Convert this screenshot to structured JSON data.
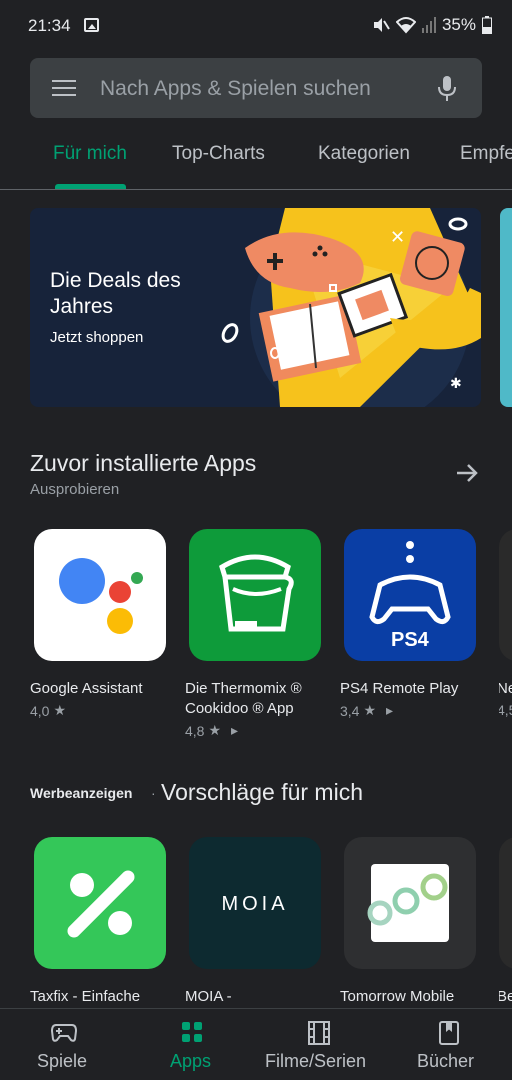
{
  "status_bar": {
    "time": "21:34",
    "battery": "35%"
  },
  "search": {
    "placeholder": "Nach Apps & Spielen suchen"
  },
  "tabs": [
    {
      "label": "Für mich",
      "active": true
    },
    {
      "label": "Top-Charts",
      "active": false
    },
    {
      "label": "Kategorien",
      "active": false
    },
    {
      "label": "Empfe",
      "active": false
    }
  ],
  "banner": {
    "title": "Die Deals des Jahres",
    "cta": "Jetzt shoppen"
  },
  "section_installed": {
    "title": "Zuvor installierte Apps",
    "subtitle": "Ausprobieren",
    "apps": [
      {
        "name_line1": "Google Assistant",
        "name_line2": "",
        "rating": "4,0",
        "icon": "google-assistant-icon"
      },
      {
        "name_line1": "Die Thermomix ®",
        "name_line2": "Cookidoo ® App",
        "rating": "4,8",
        "icon": "thermomix-icon"
      },
      {
        "name_line1": "PS4 Remote Play",
        "name_line2": "",
        "rating": "3,4",
        "icon": "ps4-icon"
      },
      {
        "name_line1": "Ne",
        "name_line2": "",
        "rating": "4,5",
        "icon": "partial-app-icon"
      }
    ],
    "ps4_label": "PS4"
  },
  "section_suggested": {
    "ads_label": "Werbeanzeigen",
    "separator": "·",
    "title": "Vorschläge für mich",
    "apps": [
      {
        "name": "Taxfix - Einfache",
        "icon": "taxfix-icon"
      },
      {
        "name": "MOIA -",
        "icon": "moia-icon"
      },
      {
        "name": "Tomorrow Mobile",
        "icon": "tomorrow-icon"
      },
      {
        "name": "Be",
        "icon": "partial-app-icon"
      }
    ],
    "moia_wordmark": "MOIA"
  },
  "bottom_nav": [
    {
      "label": "Spiele",
      "icon": "gamepad-icon",
      "active": false
    },
    {
      "label": "Apps",
      "icon": "apps-grid-icon",
      "active": true
    },
    {
      "label": "Filme/Serien",
      "icon": "film-icon",
      "active": false
    },
    {
      "label": "Bücher",
      "icon": "bookmark-book-icon",
      "active": false
    }
  ],
  "colors": {
    "background": "#202124",
    "accent": "#00a173",
    "search_bg": "#3c4043",
    "banner_bg": "#17233a"
  }
}
